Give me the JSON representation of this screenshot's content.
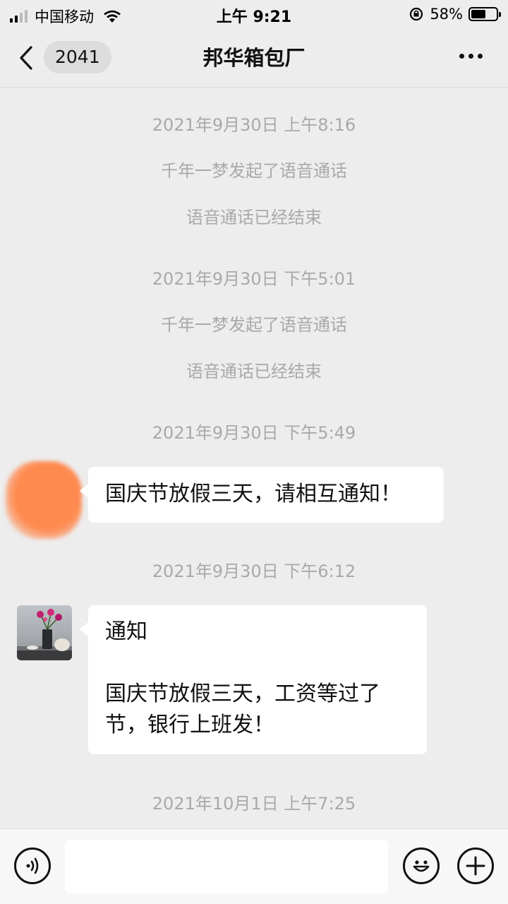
{
  "status_bar": {
    "carrier": "中国移动",
    "time": "上午 9:21",
    "battery": "58%",
    "battery_level": 0.58
  },
  "nav": {
    "back_count": "2041",
    "title": "邦华箱包厂"
  },
  "chat": {
    "sys1_time": "2021年9月30日 上午8:16",
    "sys1_call": "千年一梦发起了语音通话",
    "sys1_end": "语音通话已经结束",
    "sys2_time": "2021年9月30日 下午5:01",
    "sys2_call": "千年一梦发起了语音通话",
    "sys2_end": "语音通话已经结束",
    "sys3_time": "2021年9月30日 下午5:49",
    "msg1_text": "国庆节放假三天，请相互通知！",
    "sys4_time": "2021年9月30日 下午6:12",
    "msg2_text": "通知\n\n国庆节放假三天，工资等过了\n节，银行上班发！",
    "sys5_time": "2021年10月1日 上午7:25"
  },
  "icons": {
    "back": "chevron-left-icon",
    "more": "more-dots-icon",
    "voice": "voice-icon",
    "emoji": "emoji-icon",
    "plus": "plus-icon"
  }
}
